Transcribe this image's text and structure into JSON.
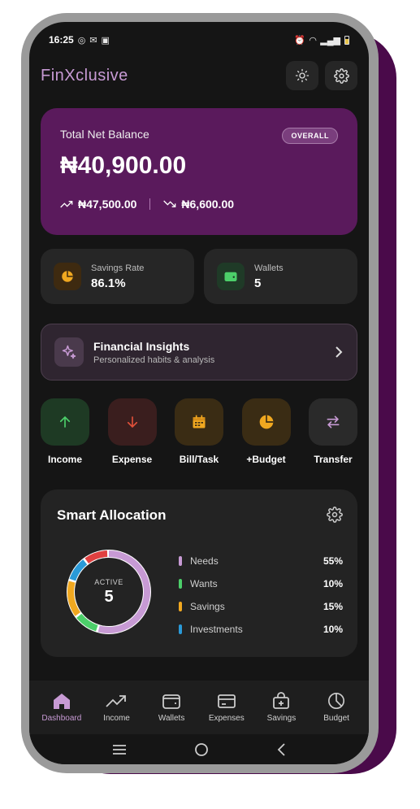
{
  "status_bar": {
    "time": "16:25"
  },
  "app": {
    "title": "FinXclusive"
  },
  "balance": {
    "label": "Total Net Balance",
    "badge": "OVERALL",
    "amount": "₦40,900.00",
    "income": "₦47,500.00",
    "expense": "₦6,600.00"
  },
  "stats": {
    "savings_rate": {
      "label": "Savings Rate",
      "value": "86.1%"
    },
    "wallets": {
      "label": "Wallets",
      "value": "5"
    }
  },
  "insights": {
    "title": "Financial Insights",
    "subtitle": "Personalized habits & analysis"
  },
  "quick_actions": [
    {
      "label": "Income",
      "icon": "arrow-up-icon",
      "color": "#4ccf6a"
    },
    {
      "label": "Expense",
      "icon": "arrow-down-icon",
      "color": "#e0503a"
    },
    {
      "label": "Bill/Task",
      "icon": "calendar-icon",
      "color": "#f0a820"
    },
    {
      "label": "+Budget",
      "icon": "pie-icon",
      "color": "#f0a820"
    },
    {
      "label": "Transfer",
      "icon": "swap-icon",
      "color": "#c79ad4"
    }
  ],
  "allocation": {
    "title": "Smart Allocation",
    "center_label": "ACTIVE",
    "center_value": "5",
    "items": [
      {
        "name": "Needs",
        "pct": "55%",
        "value": 55,
        "color": "#c79ad4"
      },
      {
        "name": "Wants",
        "pct": "10%",
        "value": 10,
        "color": "#4ccf6a"
      },
      {
        "name": "Savings",
        "pct": "15%",
        "value": 15,
        "color": "#f0a820"
      },
      {
        "name": "Investments",
        "pct": "10%",
        "value": 10,
        "color": "#2a9ad8"
      }
    ],
    "extra_segment": {
      "value": 10,
      "color": "#e04040"
    }
  },
  "nav": [
    {
      "label": "Dashboard",
      "icon": "home-icon",
      "active": true
    },
    {
      "label": "Income",
      "icon": "trend-up-icon"
    },
    {
      "label": "Wallets",
      "icon": "wallet-icon"
    },
    {
      "label": "Expenses",
      "icon": "card-icon"
    },
    {
      "label": "Savings",
      "icon": "piggy-icon"
    },
    {
      "label": "Budget",
      "icon": "pie-chart-icon"
    }
  ],
  "colors": {
    "accent": "#c79ad4",
    "card_purple": "#5a1a5c"
  }
}
